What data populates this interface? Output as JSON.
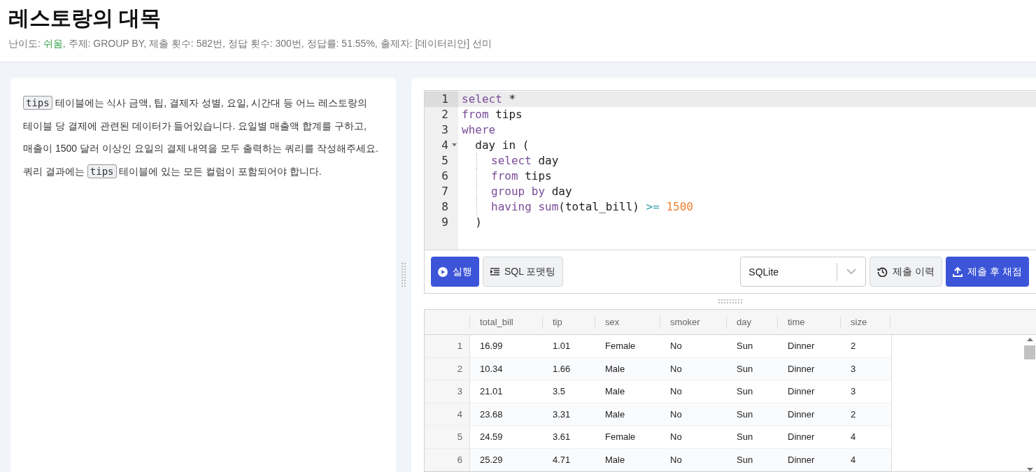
{
  "header": {
    "title": "레스토랑의 대목",
    "meta": [
      {
        "kind": "plain",
        "text": "난이도: "
      },
      {
        "kind": "difficulty",
        "text": "쉬움"
      },
      {
        "kind": "plain",
        "text": ", 주제: GROUP BY, 제출 횟수: 582번, 정답 횟수: 300번, 정답률: 51.55%, 출제자: [데이터리안] 선미"
      }
    ]
  },
  "problem": {
    "segments": [
      {
        "kind": "code",
        "text": "tips"
      },
      {
        "kind": "text",
        "text": " 테이블에는 식사 금액, 팁, 결제자 성별, 요일, 시간대 등 어느 레스토랑의 테이블 당 결제에 관련된 데이터가 들어있습니다. 요일별 매출액 합계를 구하고, 매출이 1500 달러 이상인 요일의 결제 내역을 모두 출력하는 쿼리를 작성해주세요. 쿼리 결과에는 "
      },
      {
        "kind": "code",
        "text": "tips"
      },
      {
        "kind": "text",
        "text": " 테이블에 있는 모든 컬럼이 포함되어야 합니다."
      }
    ]
  },
  "editor": {
    "lines": [
      {
        "number": "1",
        "active": true,
        "foldable": false,
        "guide": false,
        "tokens": [
          {
            "kind": "keyword",
            "text": "select"
          },
          {
            "kind": "plain",
            "text": " *"
          }
        ]
      },
      {
        "number": "2",
        "active": false,
        "foldable": false,
        "guide": false,
        "tokens": [
          {
            "kind": "keyword",
            "text": "from"
          },
          {
            "kind": "plain",
            "text": " tips"
          }
        ]
      },
      {
        "number": "3",
        "active": false,
        "foldable": false,
        "guide": false,
        "tokens": [
          {
            "kind": "keyword",
            "text": "where"
          }
        ]
      },
      {
        "number": "4",
        "active": false,
        "foldable": true,
        "guide": false,
        "tokens": [
          {
            "kind": "plain",
            "text": "  day in ("
          }
        ]
      },
      {
        "number": "5",
        "active": false,
        "foldable": false,
        "guide": true,
        "tokens": [
          {
            "kind": "keyword",
            "text": "select"
          },
          {
            "kind": "plain",
            "text": " day"
          }
        ]
      },
      {
        "number": "6",
        "active": false,
        "foldable": false,
        "guide": true,
        "tokens": [
          {
            "kind": "keyword",
            "text": "from"
          },
          {
            "kind": "plain",
            "text": " tips"
          }
        ]
      },
      {
        "number": "7",
        "active": false,
        "foldable": false,
        "guide": true,
        "tokens": [
          {
            "kind": "keyword",
            "text": "group by"
          },
          {
            "kind": "plain",
            "text": " day"
          }
        ]
      },
      {
        "number": "8",
        "active": false,
        "foldable": false,
        "guide": true,
        "tokens": [
          {
            "kind": "keyword",
            "text": "having"
          },
          {
            "kind": "function",
            "text": " sum"
          },
          {
            "kind": "plain",
            "text": "(total_bill) "
          },
          {
            "kind": "operator",
            "text": ">="
          },
          {
            "kind": "number",
            "text": " 1500"
          }
        ]
      },
      {
        "number": "9",
        "active": false,
        "foldable": false,
        "guide": false,
        "tokens": [
          {
            "kind": "plain",
            "text": "  )"
          }
        ]
      }
    ]
  },
  "toolbar": {
    "run": "실행",
    "format": "SQL 포맷팅",
    "dialect": "SQLite",
    "history": "제출 이력",
    "submit": "제출 후 채점"
  },
  "results": {
    "columns": [
      "total_bill",
      "tip",
      "sex",
      "smoker",
      "day",
      "time",
      "size"
    ],
    "rows": [
      {
        "index": "1",
        "cells": [
          "16.99",
          "1.01",
          "Female",
          "No",
          "Sun",
          "Dinner",
          "2"
        ]
      },
      {
        "index": "2",
        "cells": [
          "10.34",
          "1.66",
          "Male",
          "No",
          "Sun",
          "Dinner",
          "3"
        ]
      },
      {
        "index": "3",
        "cells": [
          "21.01",
          "3.5",
          "Male",
          "No",
          "Sun",
          "Dinner",
          "3"
        ]
      },
      {
        "index": "4",
        "cells": [
          "23.68",
          "3.31",
          "Male",
          "No",
          "Sun",
          "Dinner",
          "2"
        ]
      },
      {
        "index": "5",
        "cells": [
          "24.59",
          "3.61",
          "Female",
          "No",
          "Sun",
          "Dinner",
          "4"
        ]
      },
      {
        "index": "6",
        "cells": [
          "25.29",
          "4.71",
          "Male",
          "No",
          "Sun",
          "Dinner",
          "4"
        ]
      }
    ]
  }
}
